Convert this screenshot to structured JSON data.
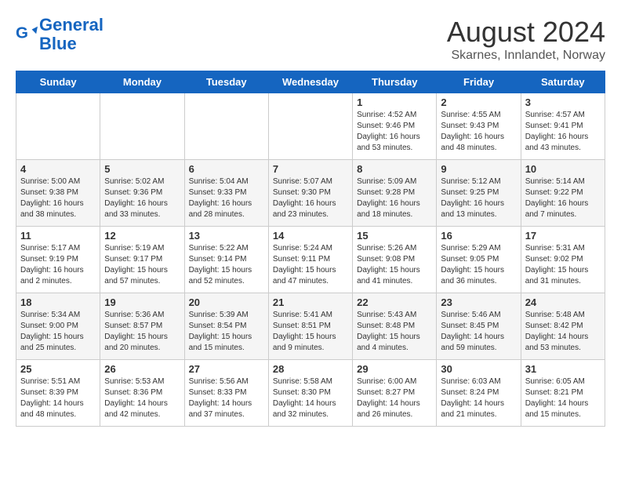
{
  "header": {
    "logo_line1": "General",
    "logo_line2": "Blue",
    "month_title": "August 2024",
    "location": "Skarnes, Innlandet, Norway"
  },
  "days_of_week": [
    "Sunday",
    "Monday",
    "Tuesday",
    "Wednesday",
    "Thursday",
    "Friday",
    "Saturday"
  ],
  "weeks": [
    [
      {
        "day": "",
        "info": ""
      },
      {
        "day": "",
        "info": ""
      },
      {
        "day": "",
        "info": ""
      },
      {
        "day": "",
        "info": ""
      },
      {
        "day": "1",
        "info": "Sunrise: 4:52 AM\nSunset: 9:46 PM\nDaylight: 16 hours\nand 53 minutes."
      },
      {
        "day": "2",
        "info": "Sunrise: 4:55 AM\nSunset: 9:43 PM\nDaylight: 16 hours\nand 48 minutes."
      },
      {
        "day": "3",
        "info": "Sunrise: 4:57 AM\nSunset: 9:41 PM\nDaylight: 16 hours\nand 43 minutes."
      }
    ],
    [
      {
        "day": "4",
        "info": "Sunrise: 5:00 AM\nSunset: 9:38 PM\nDaylight: 16 hours\nand 38 minutes."
      },
      {
        "day": "5",
        "info": "Sunrise: 5:02 AM\nSunset: 9:36 PM\nDaylight: 16 hours\nand 33 minutes."
      },
      {
        "day": "6",
        "info": "Sunrise: 5:04 AM\nSunset: 9:33 PM\nDaylight: 16 hours\nand 28 minutes."
      },
      {
        "day": "7",
        "info": "Sunrise: 5:07 AM\nSunset: 9:30 PM\nDaylight: 16 hours\nand 23 minutes."
      },
      {
        "day": "8",
        "info": "Sunrise: 5:09 AM\nSunset: 9:28 PM\nDaylight: 16 hours\nand 18 minutes."
      },
      {
        "day": "9",
        "info": "Sunrise: 5:12 AM\nSunset: 9:25 PM\nDaylight: 16 hours\nand 13 minutes."
      },
      {
        "day": "10",
        "info": "Sunrise: 5:14 AM\nSunset: 9:22 PM\nDaylight: 16 hours\nand 7 minutes."
      }
    ],
    [
      {
        "day": "11",
        "info": "Sunrise: 5:17 AM\nSunset: 9:19 PM\nDaylight: 16 hours\nand 2 minutes."
      },
      {
        "day": "12",
        "info": "Sunrise: 5:19 AM\nSunset: 9:17 PM\nDaylight: 15 hours\nand 57 minutes."
      },
      {
        "day": "13",
        "info": "Sunrise: 5:22 AM\nSunset: 9:14 PM\nDaylight: 15 hours\nand 52 minutes."
      },
      {
        "day": "14",
        "info": "Sunrise: 5:24 AM\nSunset: 9:11 PM\nDaylight: 15 hours\nand 47 minutes."
      },
      {
        "day": "15",
        "info": "Sunrise: 5:26 AM\nSunset: 9:08 PM\nDaylight: 15 hours\nand 41 minutes."
      },
      {
        "day": "16",
        "info": "Sunrise: 5:29 AM\nSunset: 9:05 PM\nDaylight: 15 hours\nand 36 minutes."
      },
      {
        "day": "17",
        "info": "Sunrise: 5:31 AM\nSunset: 9:02 PM\nDaylight: 15 hours\nand 31 minutes."
      }
    ],
    [
      {
        "day": "18",
        "info": "Sunrise: 5:34 AM\nSunset: 9:00 PM\nDaylight: 15 hours\nand 25 minutes."
      },
      {
        "day": "19",
        "info": "Sunrise: 5:36 AM\nSunset: 8:57 PM\nDaylight: 15 hours\nand 20 minutes."
      },
      {
        "day": "20",
        "info": "Sunrise: 5:39 AM\nSunset: 8:54 PM\nDaylight: 15 hours\nand 15 minutes."
      },
      {
        "day": "21",
        "info": "Sunrise: 5:41 AM\nSunset: 8:51 PM\nDaylight: 15 hours\nand 9 minutes."
      },
      {
        "day": "22",
        "info": "Sunrise: 5:43 AM\nSunset: 8:48 PM\nDaylight: 15 hours\nand 4 minutes."
      },
      {
        "day": "23",
        "info": "Sunrise: 5:46 AM\nSunset: 8:45 PM\nDaylight: 14 hours\nand 59 minutes."
      },
      {
        "day": "24",
        "info": "Sunrise: 5:48 AM\nSunset: 8:42 PM\nDaylight: 14 hours\nand 53 minutes."
      }
    ],
    [
      {
        "day": "25",
        "info": "Sunrise: 5:51 AM\nSunset: 8:39 PM\nDaylight: 14 hours\nand 48 minutes."
      },
      {
        "day": "26",
        "info": "Sunrise: 5:53 AM\nSunset: 8:36 PM\nDaylight: 14 hours\nand 42 minutes."
      },
      {
        "day": "27",
        "info": "Sunrise: 5:56 AM\nSunset: 8:33 PM\nDaylight: 14 hours\nand 37 minutes."
      },
      {
        "day": "28",
        "info": "Sunrise: 5:58 AM\nSunset: 8:30 PM\nDaylight: 14 hours\nand 32 minutes."
      },
      {
        "day": "29",
        "info": "Sunrise: 6:00 AM\nSunset: 8:27 PM\nDaylight: 14 hours\nand 26 minutes."
      },
      {
        "day": "30",
        "info": "Sunrise: 6:03 AM\nSunset: 8:24 PM\nDaylight: 14 hours\nand 21 minutes."
      },
      {
        "day": "31",
        "info": "Sunrise: 6:05 AM\nSunset: 8:21 PM\nDaylight: 14 hours\nand 15 minutes."
      }
    ]
  ]
}
